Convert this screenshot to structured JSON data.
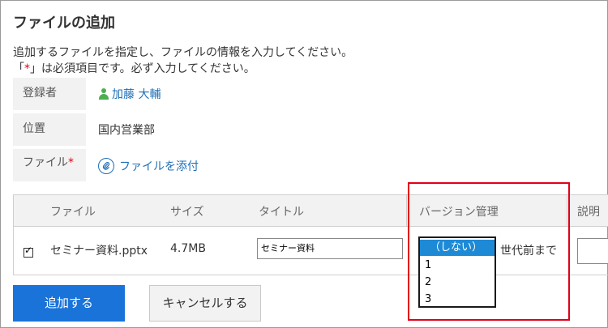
{
  "page": {
    "title": "ファイルの追加",
    "desc1": "追加するファイルを指定し、ファイルの情報を入力してください。",
    "desc2_prefix": "「",
    "desc2_star": "*",
    "desc2_suffix": "」は必須項目です。必ず入力してください。"
  },
  "info": {
    "registrant_label": "登録者",
    "registrant_value": "加藤 大輔",
    "location_label": "位置",
    "location_value": "国内営業部",
    "file_label": "ファイル",
    "file_required": "*",
    "attach_link": "ファイルを添付"
  },
  "table": {
    "headers": [
      "ファイル",
      "サイズ",
      "タイトル",
      "バージョン管理",
      "説明"
    ],
    "row": {
      "checked": true,
      "filename": "セミナー資料.pptx",
      "size": "4.7MB",
      "title_value": "セミナー資料",
      "version_suffix": "世代前まで"
    }
  },
  "version_dropdown": {
    "options": [
      "（しない）",
      "1",
      "2",
      "3"
    ],
    "selected_index": 0
  },
  "buttons": {
    "add": "追加する",
    "cancel": "キャンセルする"
  },
  "colors": {
    "primary": "#1a73d9",
    "highlight": "#e2001a",
    "link": "#1d6fb8",
    "required": "#e60012"
  }
}
